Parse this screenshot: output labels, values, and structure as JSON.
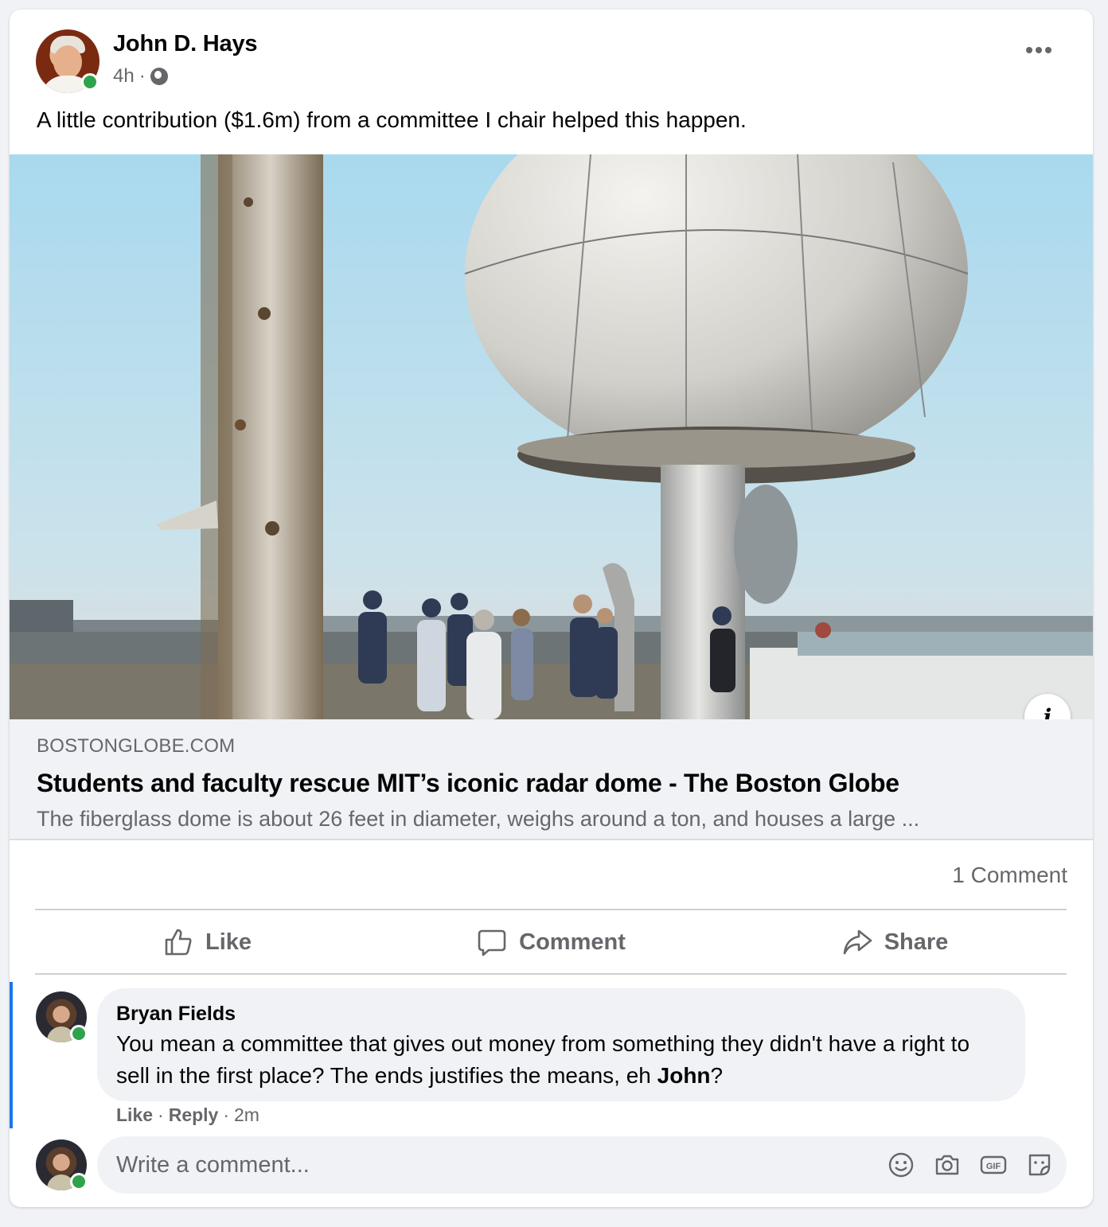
{
  "post": {
    "author": "John D. Hays",
    "time": "4h",
    "separator": "·",
    "text": "A little contribution ($1.6m) from a committee I chair helped this happen."
  },
  "link_preview": {
    "domain": "BOSTONGLOBE.COM",
    "title": "Students and faculty rescue MIT’s iconic radar dome - The Boston Globe",
    "description": "The fiberglass dome is about 26 feet in diameter, weighs around a ton, and houses a large ...",
    "info_icon": "info-icon"
  },
  "stats": {
    "comments": "1 Comment"
  },
  "actions": {
    "like": "Like",
    "comment": "Comment",
    "share": "Share"
  },
  "comment": {
    "author": "Bryan Fields",
    "text_before": "You mean a committee that gives out money from something they didn't have a right to sell in the first place? The ends justifies the means, eh ",
    "mention": "John",
    "text_after": "?",
    "like": "Like",
    "reply": "Reply",
    "time": "2m",
    "dot": "·"
  },
  "composer": {
    "placeholder": "Write a comment..."
  },
  "colors": {
    "accent": "#1877f2",
    "online": "#31a24c",
    "secondary_text": "#65676b"
  }
}
